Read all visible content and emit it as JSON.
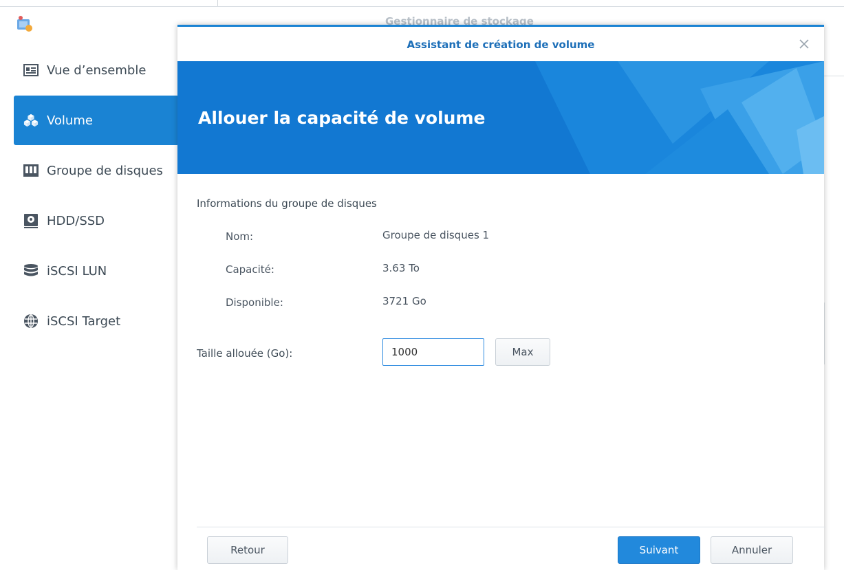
{
  "app": {
    "title": "Gestionnaire de stockage"
  },
  "sidebar": {
    "items": [
      {
        "label": "Vue d’ensemble",
        "icon": "overview-card-icon",
        "active": false
      },
      {
        "label": "Volume",
        "icon": "volume-cubes-icon",
        "active": true
      },
      {
        "label": "Groupe de disques",
        "icon": "disk-group-icon",
        "active": false
      },
      {
        "label": "HDD/SSD",
        "icon": "hdd-icon",
        "active": false
      },
      {
        "label": "iSCSI LUN",
        "icon": "database-icon",
        "active": false
      },
      {
        "label": "iSCSI Target",
        "icon": "globe-icon",
        "active": false
      }
    ]
  },
  "dialog": {
    "title": "Assistant de création de volume",
    "heading": "Allouer la capacité de volume",
    "info_title": "Informations du groupe de disques",
    "info": [
      {
        "label": "Nom:",
        "value": "Groupe de disques 1"
      },
      {
        "label": "Capacité:",
        "value": "3.63 To"
      },
      {
        "label": "Disponible:",
        "value": "3721 Go"
      }
    ],
    "size_label": "Taille allouée (Go):",
    "size_value": "1000",
    "max_label": "Max",
    "back_label": "Retour",
    "next_label": "Suivant",
    "cancel_label": "Annuler"
  },
  "colors": {
    "accent": "#1a83d3",
    "banner": "#1278d2",
    "title_text": "#1d6fb8"
  }
}
